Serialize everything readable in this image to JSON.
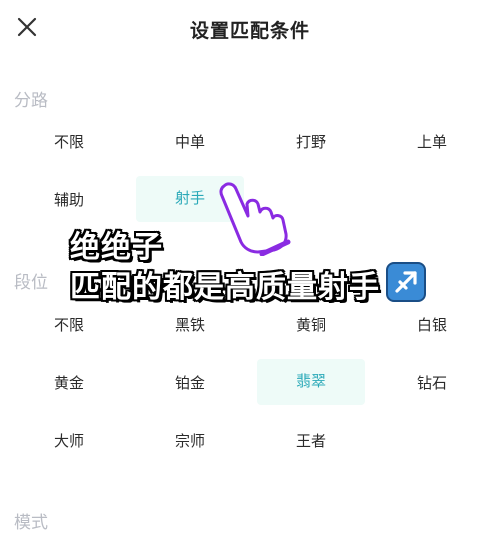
{
  "header": {
    "title": "设置匹配条件",
    "close_icon": "close-icon"
  },
  "sections": {
    "lane": {
      "label": "分路",
      "options": [
        "不限",
        "中单",
        "打野",
        "上单",
        "辅助",
        "射手"
      ],
      "selected": "射手"
    },
    "rank": {
      "label": "段位",
      "options": [
        "不限",
        "黑铁",
        "黄铜",
        "白银",
        "黄金",
        "铂金",
        "翡翠",
        "钻石",
        "大师",
        "宗师",
        "王者"
      ],
      "selected": "翡翠"
    },
    "mode": {
      "label": "模式"
    }
  },
  "overlay": {
    "line1": "绝绝子",
    "line2": "匹配的都是高质量射手",
    "emoji_icon": "sagittarius-icon",
    "pointer_icon": "pointing-hand-icon"
  },
  "colors": {
    "selected_bg": "#eefbf8",
    "selected_text": "#2aa9b8",
    "section_label": "#b9bcc4",
    "hand_outline": "#8a2be2"
  }
}
